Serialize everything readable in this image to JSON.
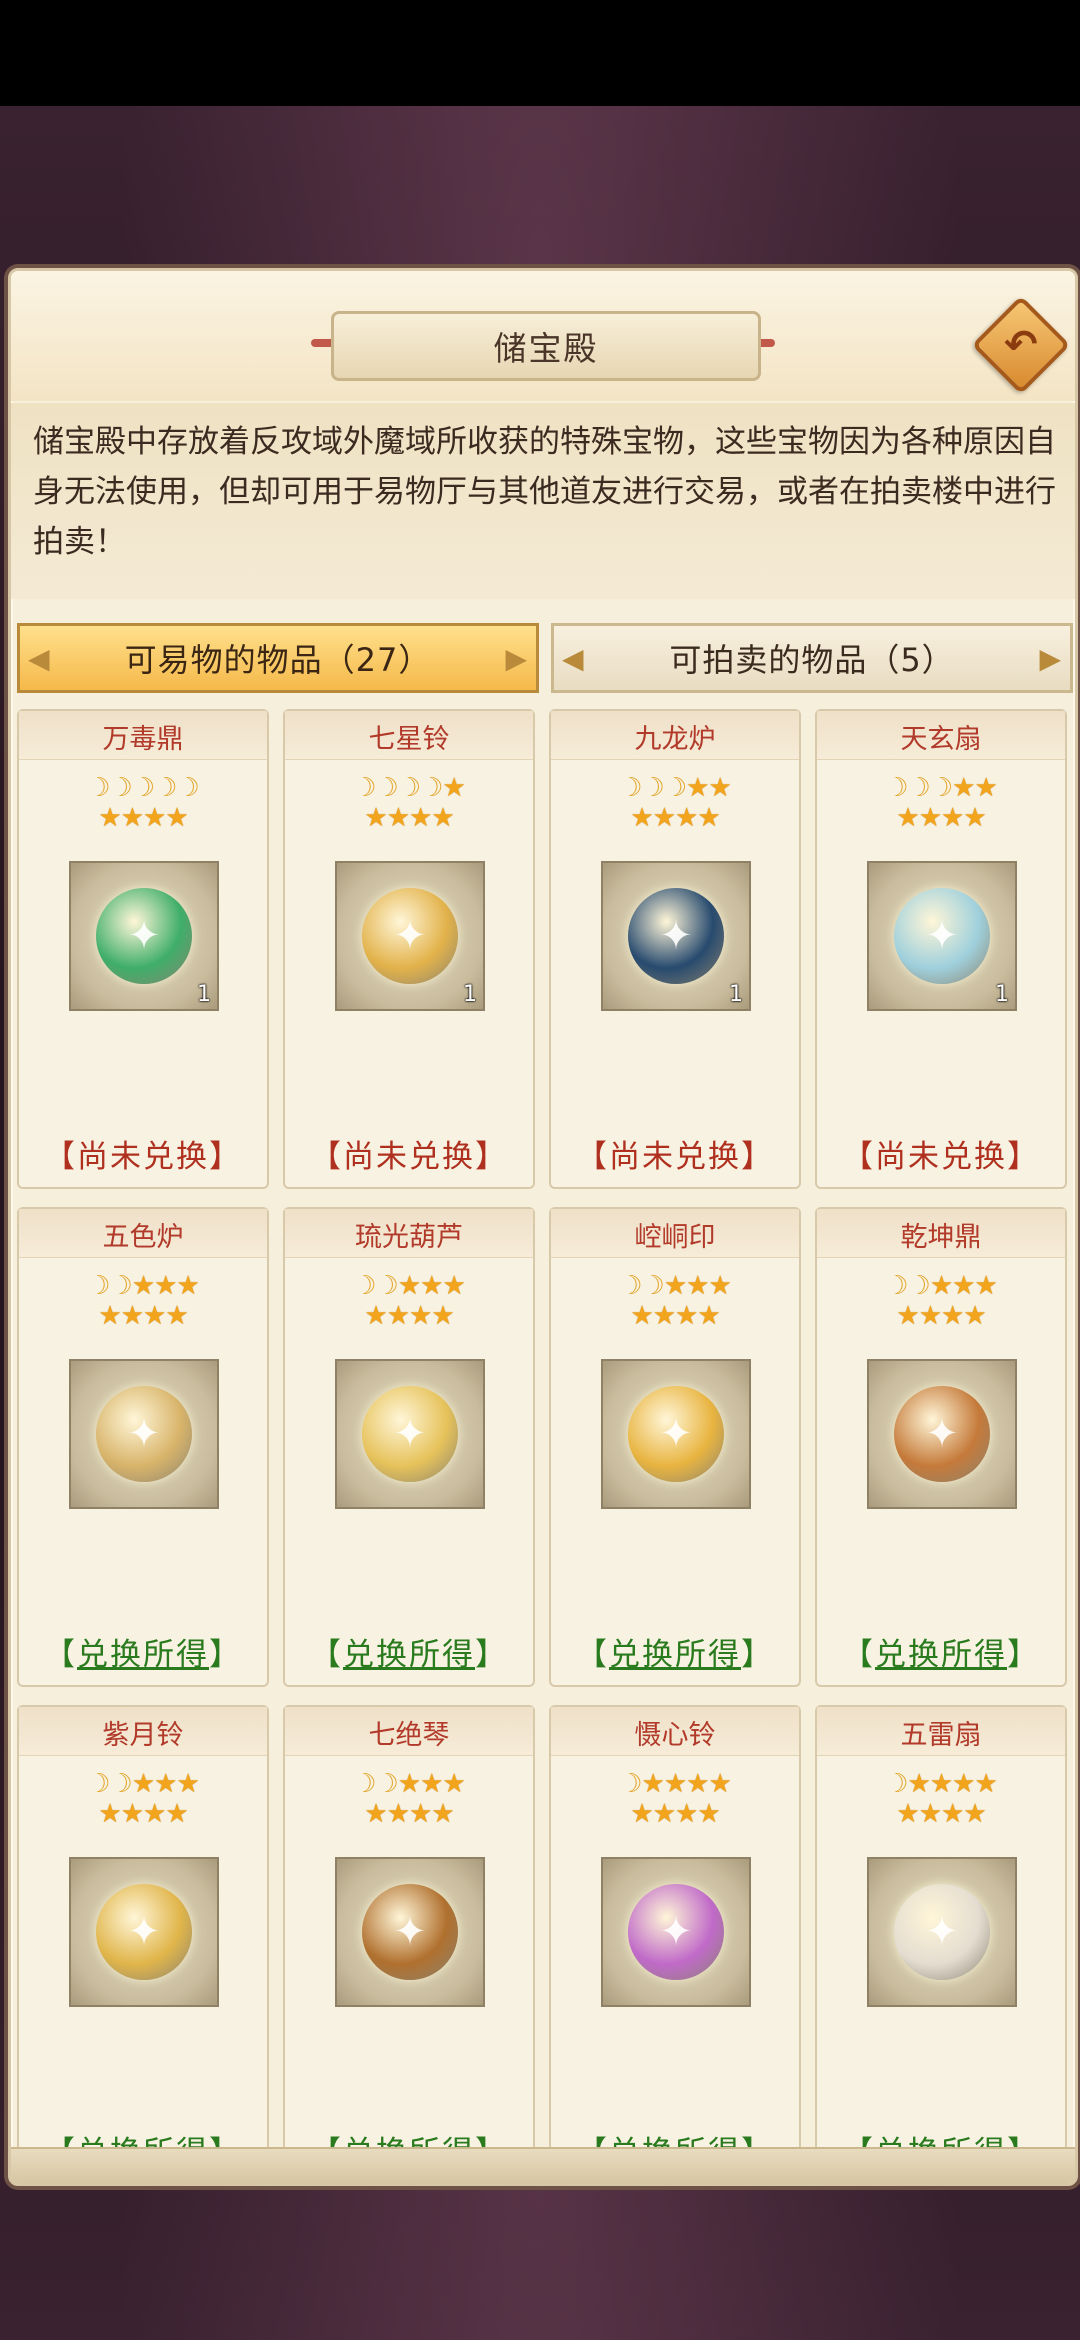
{
  "header": {
    "title": "储宝殿",
    "back_icon": "back-arrow-icon"
  },
  "description": "储宝殿中存放着反攻域外魔域所收获的特殊宝物，这些宝物因为各种原因自身无法使用，但却可用于易物厅与其他道友进行交易，或者在拍卖楼中进行拍卖！",
  "tabs": [
    {
      "label": "可易物的物品（27）",
      "active": true
    },
    {
      "label": "可拍卖的物品（5）",
      "active": false
    }
  ],
  "status_labels": {
    "pending": "尚未兑换",
    "claim": "兑换所得"
  },
  "colors": {
    "accent_gold": "#f5b94a",
    "name_red": "#b23a2a",
    "pending_red": "#b0301f",
    "claim_green": "#2a7a1e"
  },
  "items": [
    {
      "name": "万毒鼎",
      "moons": 5,
      "stars": 4,
      "count": "1",
      "status": "pending",
      "icon": "poison-cauldron-icon",
      "color": "#3fae6a"
    },
    {
      "name": "七星铃",
      "moons": 4,
      "stars": 5,
      "count": "1",
      "status": "pending",
      "icon": "seven-star-bell-icon",
      "color": "#e2b24a"
    },
    {
      "name": "九龙炉",
      "moons": 3,
      "stars": 6,
      "count": "1",
      "status": "pending",
      "icon": "nine-dragon-furnace-icon",
      "color": "#274a6e"
    },
    {
      "name": "天玄扇",
      "moons": 3,
      "stars": 6,
      "count": "1",
      "status": "pending",
      "icon": "heaven-fan-icon",
      "color": "#9fd0dc"
    },
    {
      "name": "五色炉",
      "moons": 2,
      "stars": 7,
      "count": "",
      "status": "claim",
      "icon": "five-color-furnace-icon",
      "color": "#d8b46a"
    },
    {
      "name": "琉光葫芦",
      "moons": 2,
      "stars": 7,
      "count": "",
      "status": "claim",
      "icon": "glow-gourd-icon",
      "color": "#e6c25a"
    },
    {
      "name": "崆峒印",
      "moons": 2,
      "stars": 7,
      "count": "",
      "status": "claim",
      "icon": "kongtong-seal-icon",
      "color": "#e8b440"
    },
    {
      "name": "乾坤鼎",
      "moons": 2,
      "stars": 7,
      "count": "",
      "status": "claim",
      "icon": "qiankun-cauldron-icon",
      "color": "#c57a3a"
    },
    {
      "name": "紫月铃",
      "moons": 2,
      "stars": 7,
      "count": "",
      "status": "claim",
      "icon": "purple-moon-bell-icon",
      "color": "#e0b54a"
    },
    {
      "name": "七绝琴",
      "moons": 2,
      "stars": 7,
      "count": "",
      "status": "claim",
      "icon": "seven-strings-zither-icon",
      "color": "#b0702e"
    },
    {
      "name": "慑心铃",
      "moons": 1,
      "stars": 8,
      "count": "",
      "status": "claim",
      "icon": "soul-bell-icon",
      "color": "#c06ac8"
    },
    {
      "name": "五雷扇",
      "moons": 1,
      "stars": 8,
      "count": "",
      "status": "claim",
      "icon": "thunder-fan-icon",
      "color": "#e4dcd0"
    }
  ]
}
